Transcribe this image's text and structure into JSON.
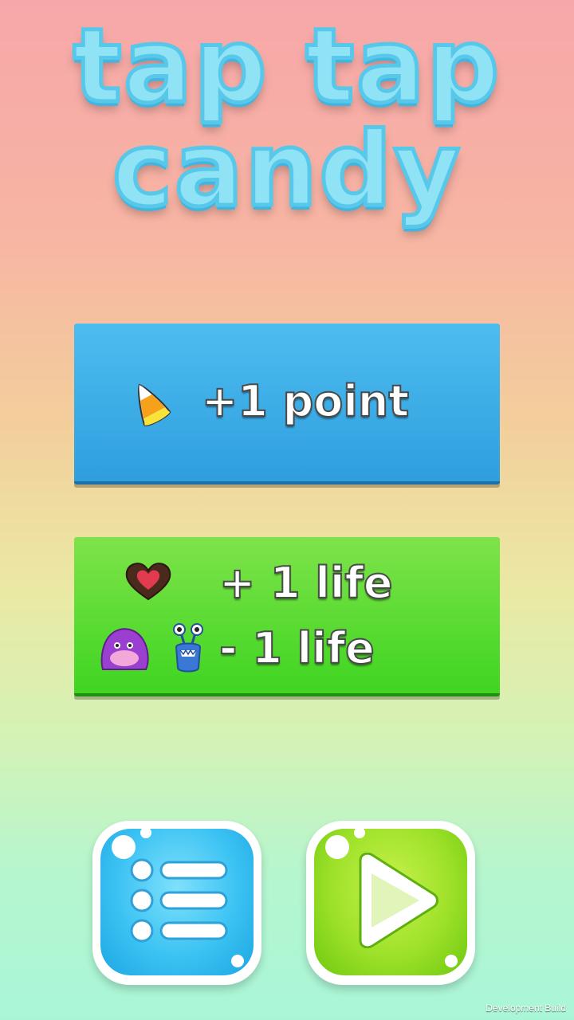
{
  "title": {
    "line1": "tap tap",
    "line2": "candy"
  },
  "rules": {
    "point": "+1 POINT",
    "gain_life": "+ 1 life",
    "lose_life": "- 1 life"
  },
  "icons": {
    "candy_corn": "candy-corn-icon",
    "heart_chocolate": "heart-chocolate-icon",
    "purple_monster": "purple-monster-icon",
    "blue_monster": "blue-monster-icon",
    "menu": "list-menu-icon",
    "play": "play-icon"
  },
  "colors": {
    "title_fill": "#8fe3f5",
    "point_panel": "#3aa9e6",
    "life_panel": "#5ad935",
    "menu_button": "#3cc3f3",
    "play_button": "#9ee12a"
  },
  "footer": {
    "dev_build": "Development Build"
  }
}
